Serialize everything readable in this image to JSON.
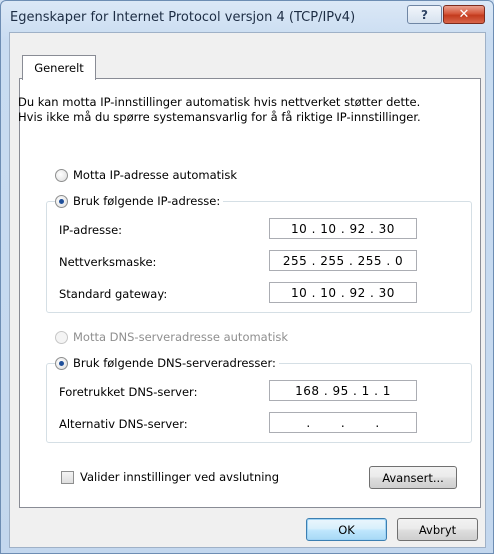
{
  "window": {
    "title": "Egenskaper for Internet Protocol versjon 4 (TCP/IPv4)",
    "help_label": "?",
    "close_label": "✕"
  },
  "tabs": [
    {
      "label": "Generelt",
      "selected": true
    }
  ],
  "intro": {
    "line1": "Du kan motta IP-innstillinger automatisk hvis nettverket støtter dette.",
    "line2": "Hvis ikke må du spørre systemansvarlig for å få riktige IP-innstillinger."
  },
  "ip": {
    "auto_label": "Motta IP-adresse automatisk",
    "auto_checked": false,
    "manual_label": "Bruk følgende IP-adresse:",
    "manual_checked": true,
    "fields": [
      {
        "label": "IP-adresse:",
        "value": "10 . 10 . 92 . 30"
      },
      {
        "label": "Nettverksmaske:",
        "value": "255 . 255 . 255 . 0"
      },
      {
        "label": "Standard gateway:",
        "value": "10 . 10 . 92 . 30"
      }
    ]
  },
  "dns": {
    "auto_label": "Motta DNS-serveradresse automatisk",
    "auto_enabled": false,
    "manual_label": "Bruk følgende DNS-serveradresser:",
    "manual_checked": true,
    "fields": [
      {
        "label": "Foretrukket DNS-server:",
        "value": "168 . 95 . 1 . 1"
      },
      {
        "label": "Alternativ DNS-server:",
        "value": "   .       .       .   "
      }
    ]
  },
  "validate": {
    "label": "Valider innstillinger ved avslutning",
    "checked": false
  },
  "buttons": {
    "advanced": "Avansert...",
    "ok": "OK",
    "cancel": "Avbryt"
  },
  "colors": {
    "title_bg": "#c9dcf1",
    "close_red": "#c33b1e",
    "dialog_bg": "#f0f0f0",
    "radio_dot": "#1f4f9a"
  }
}
